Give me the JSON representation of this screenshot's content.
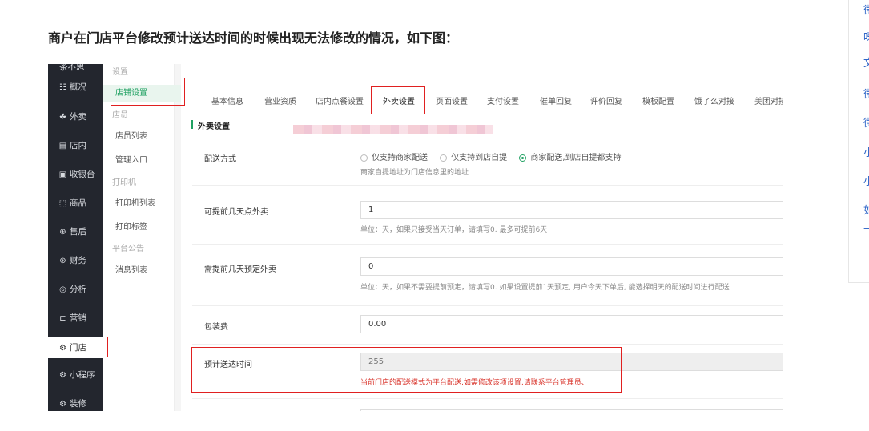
{
  "heading": "商户在门店平台修改预计送达时间的时候出现无法修改的情况，如下图：",
  "nav": {
    "top_label": "茶不思",
    "items": [
      {
        "icon": "☷",
        "label": "概况"
      },
      {
        "icon": "☘",
        "label": "外卖"
      },
      {
        "icon": "▤",
        "label": "店内"
      },
      {
        "icon": "▣",
        "label": "收银台"
      },
      {
        "icon": "⬚",
        "label": "商品"
      },
      {
        "icon": "⊕",
        "label": "售后"
      },
      {
        "icon": "⊛",
        "label": "财务"
      },
      {
        "icon": "◎",
        "label": "分析"
      },
      {
        "icon": "⊏",
        "label": "营销"
      },
      {
        "icon": "⚙",
        "label": "门店"
      },
      {
        "icon": "⚙",
        "label": "小程序"
      },
      {
        "icon": "⚙",
        "label": "装修"
      }
    ]
  },
  "submenu": [
    {
      "type": "group",
      "label": "设置"
    },
    {
      "type": "link",
      "label": "店铺设置",
      "selected": true
    },
    {
      "type": "group",
      "label": "店员"
    },
    {
      "type": "link",
      "label": "店员列表"
    },
    {
      "type": "link",
      "label": "管理入口"
    },
    {
      "type": "group",
      "label": "打印机"
    },
    {
      "type": "link",
      "label": "打印机列表"
    },
    {
      "type": "link",
      "label": "打印标签"
    },
    {
      "type": "group",
      "label": "平台公告"
    },
    {
      "type": "link",
      "label": "消息列表"
    }
  ],
  "tabs": [
    "基本信息",
    "营业资质",
    "店内点餐设置",
    "外卖设置",
    "页面设置",
    "支付设置",
    "催单回复",
    "评价回复",
    "模板配置",
    "饿了么对接",
    "美团对接"
  ],
  "active_tab": "外卖设置",
  "section": {
    "title": "外卖设置"
  },
  "form": {
    "delivery": {
      "label": "配送方式",
      "options": [
        "仅支持商家配送",
        "仅支持到店自提",
        "商家配送,到店自提都支持"
      ],
      "selected": "商家配送,到店自提都支持",
      "hint": "商家自提地址为门店信息里的地址"
    },
    "days_ahead": {
      "label": "可提前几天点外卖",
      "value": "1",
      "hint": "单位：天，如果只接受当天订单，请填写0. 最多可提前6天"
    },
    "preorder_days": {
      "label": "需提前几天预定外卖",
      "value": "0",
      "hint": "单位：天，如果不需要提前预定，请填写0. 如果设置提前1天预定, 用户今天下单后, 能选择明天的配送时间进行配送"
    },
    "packaging": {
      "label": "包装费",
      "value": "0.00"
    },
    "eta": {
      "label": "预计送达时间",
      "value": "255",
      "error": "当前门店的配送模式为平台配送,如需修改该项设置,请联系平台管理员、"
    }
  },
  "right_panel_chars": [
    "微",
    "呀",
    "文",
    "微",
    "微",
    "小",
    "小",
    "如",
    "—"
  ],
  "colors": {
    "accent": "#20a162",
    "error": "#d9342b",
    "highlight_box": "#e02020",
    "link": "#2f66c8",
    "nav_bg": "#23262e"
  }
}
